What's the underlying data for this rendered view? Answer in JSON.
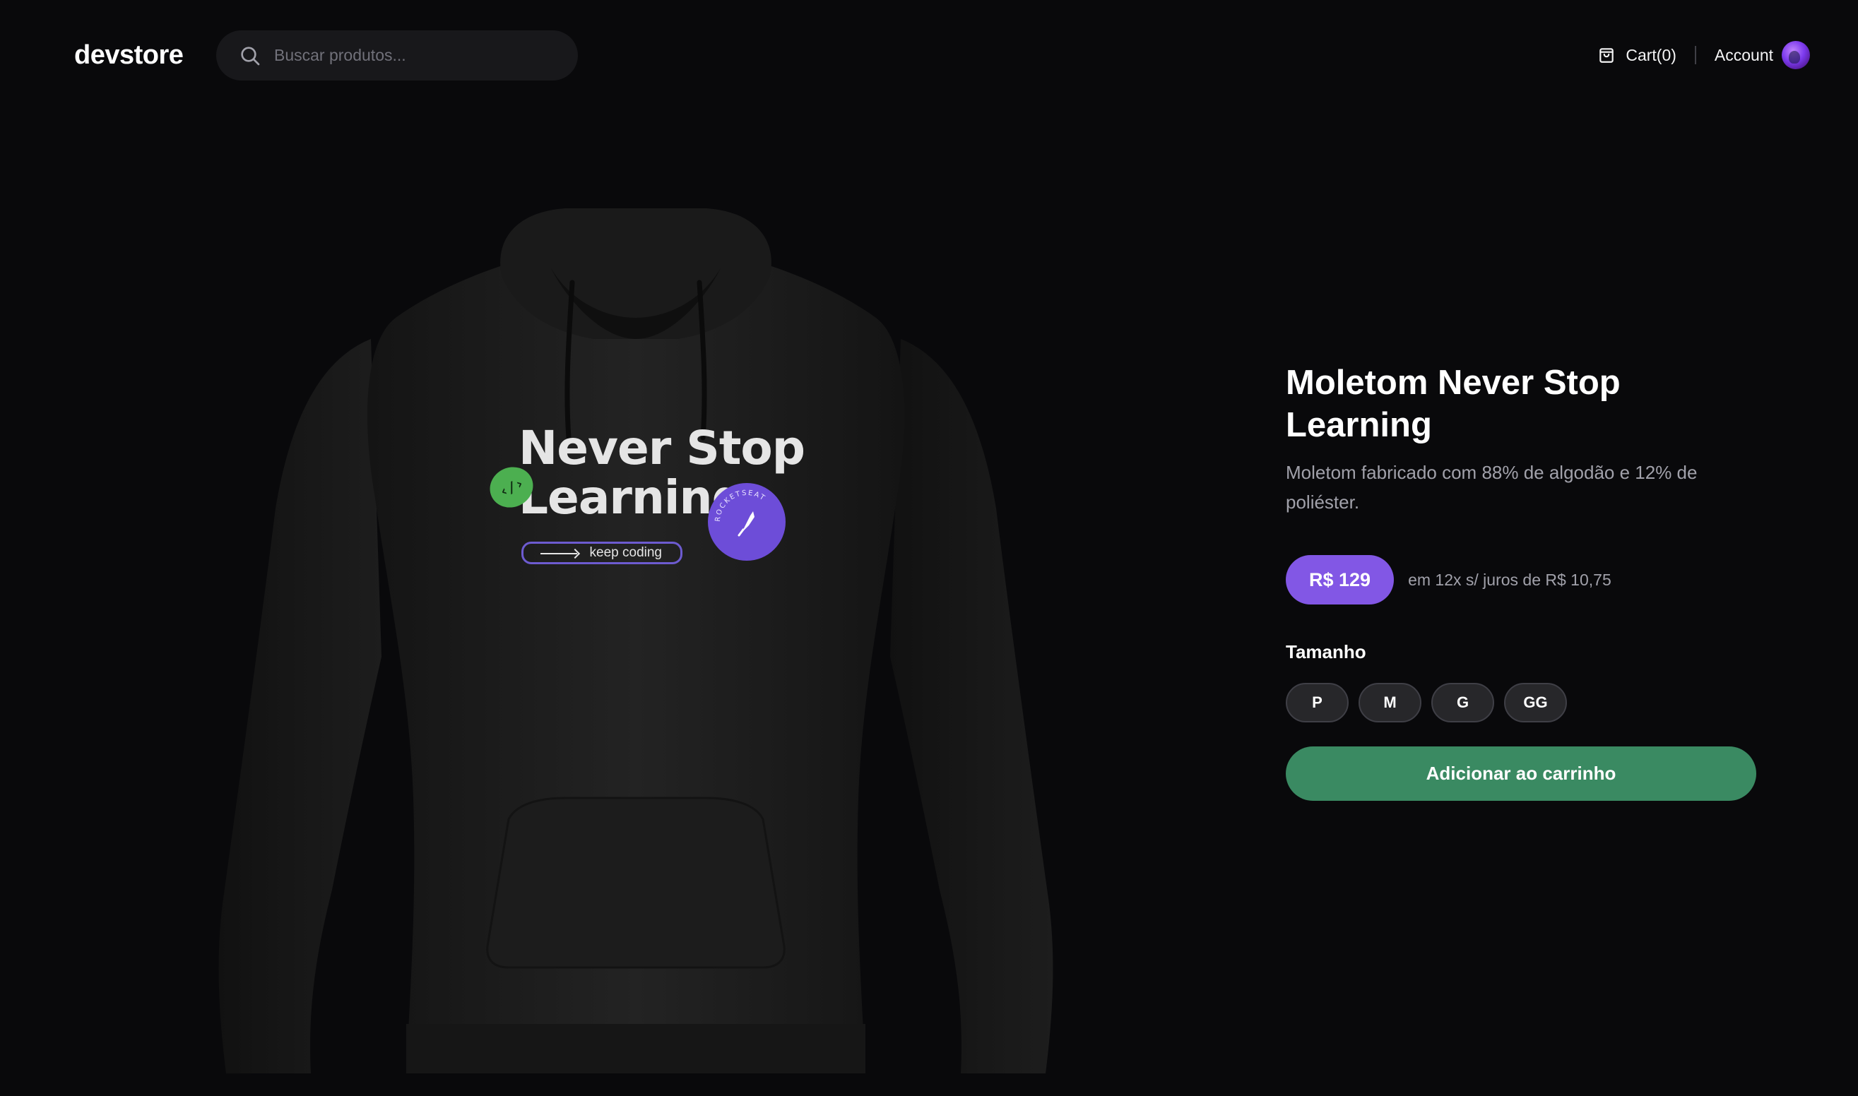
{
  "header": {
    "logo": "devstore",
    "search": {
      "placeholder": "Buscar produtos...",
      "value": ""
    },
    "cart_label": "Cart(0)",
    "account_label": "Account"
  },
  "product": {
    "image_alt": "Moletom Never Stop Learning hoodie",
    "print": {
      "headline": "Never Stop\nLearning",
      "tag": "keep coding",
      "badge": "‹/›",
      "seal_text": "ROCKETSEAT"
    },
    "title": "Moletom Never Stop Learning",
    "description": "Moletom fabricado com 88% de algodão e 12% de poliéster.",
    "price": "R$ 129",
    "installments": "em 12x s/ juros de R$ 10,75",
    "size_label": "Tamanho",
    "sizes": [
      "P",
      "M",
      "G",
      "GG"
    ],
    "add_to_cart": "Adicionar ao carrinho"
  },
  "colors": {
    "background": "#09090b",
    "price_pill": "#8257e5",
    "add_button": "#3a8a62",
    "hoodie": "#1f1f1f"
  },
  "icons": {
    "search": "search-icon",
    "cart": "shopping-bag-icon"
  }
}
